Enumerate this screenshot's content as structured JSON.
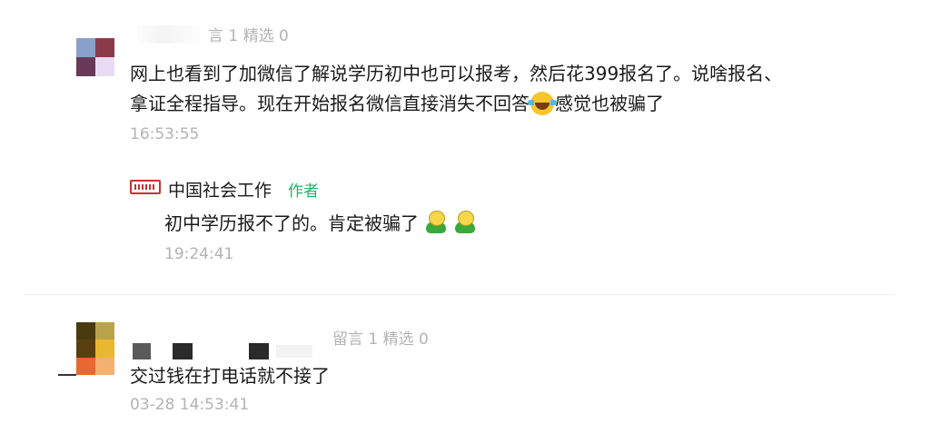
{
  "comments": [
    {
      "meta": "言 1 精选 0",
      "text_part1": "网上也看到了加微信了解说学历初中也可以报考，然后花399报名了。说啥报名、拿证全程指导。现在开始报名微信直接消失不回答",
      "emoji": "laugh-cry-emoji",
      "text_part2": "感觉也被骗了",
      "time": "16:53:55",
      "reply": {
        "name": "中国社会工作",
        "tag": "作者",
        "text": "初中学历报不了的。肯定被骗了",
        "time": "19:24:41"
      }
    },
    {
      "meta": "留言 1 精选 0",
      "text": "交过钱在打电话就不接了",
      "time": "03-28 14:53:41"
    }
  ]
}
